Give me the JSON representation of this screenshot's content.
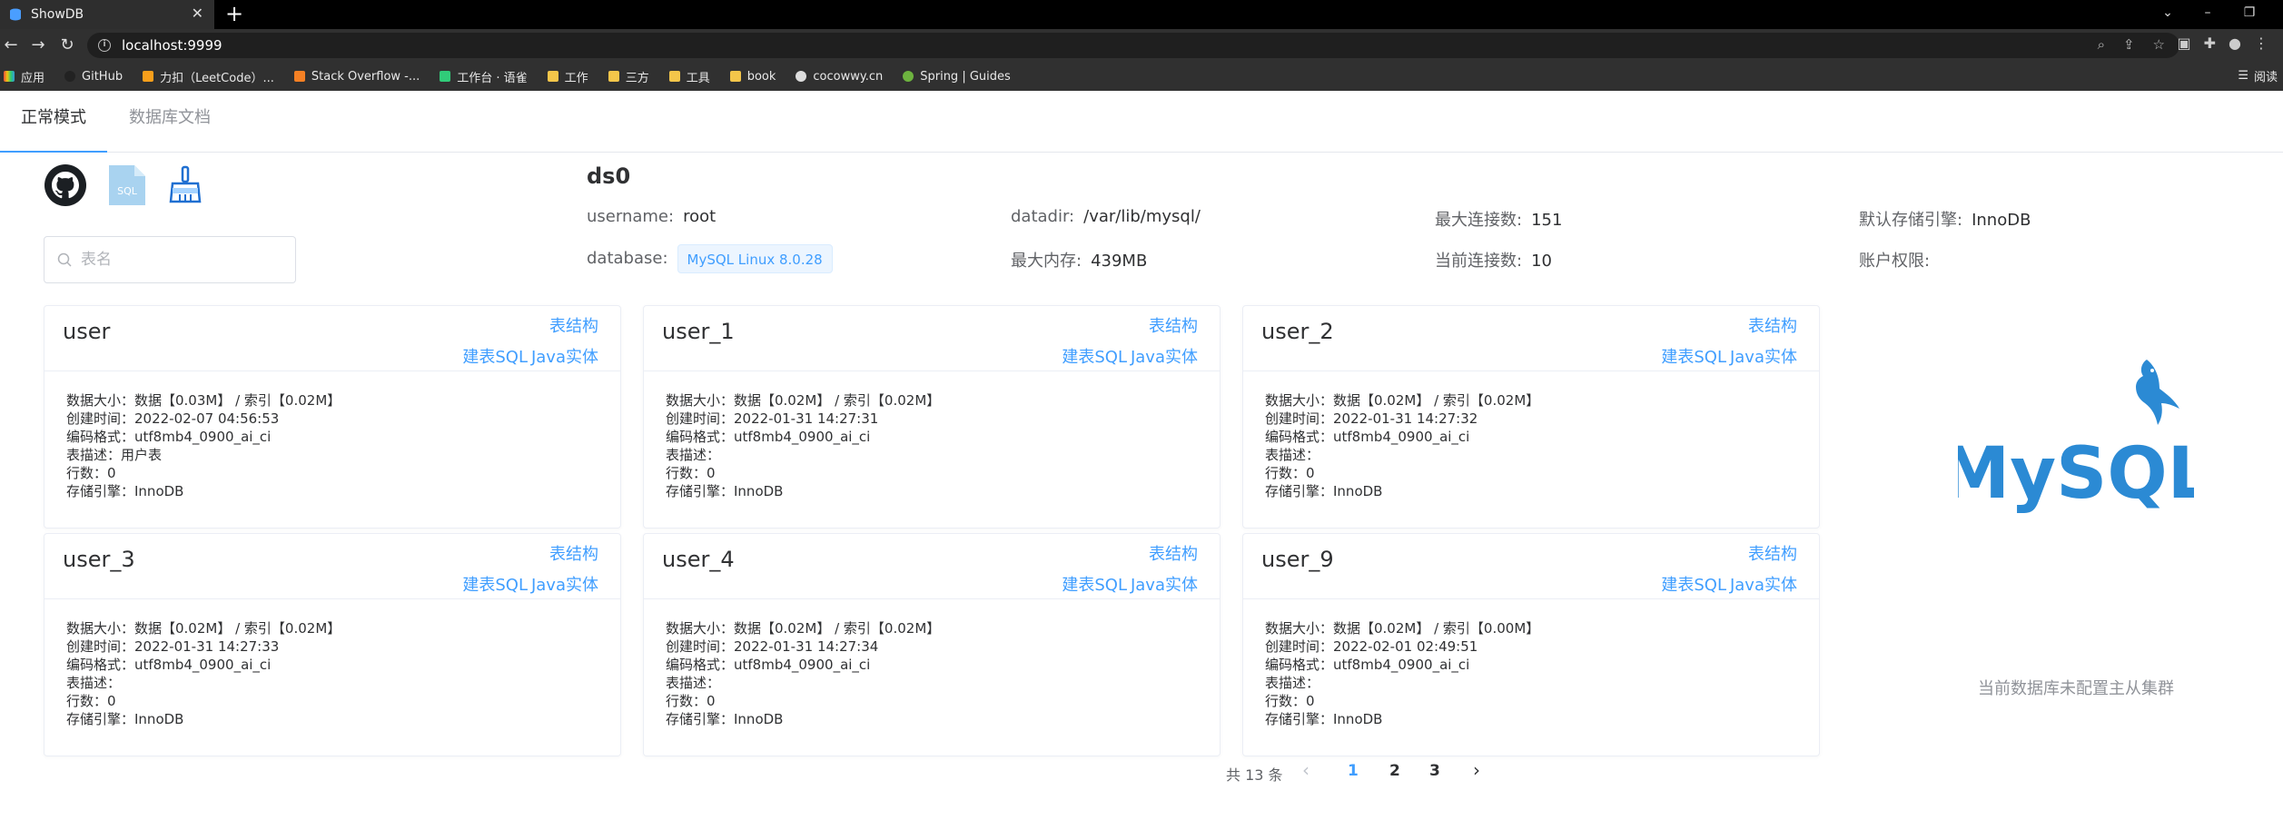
{
  "browser": {
    "tab_title": "ShowDB",
    "url": "localhost:9999",
    "bookmarks": [
      "应用",
      "GitHub",
      "力扣（LeetCode）...",
      "Stack Overflow -...",
      "工作台 · 语雀",
      "工作",
      "三方",
      "工具",
      "book",
      "cocowwy.cn",
      "Spring | Guides"
    ],
    "reading_list": "阅读"
  },
  "app_tabs": {
    "normal": "正常模式",
    "docs": "数据库文档"
  },
  "search": {
    "placeholder": "表名"
  },
  "db": {
    "name": "ds0",
    "username_label": "username:",
    "username": "root",
    "database_label": "database:",
    "database": "MySQL Linux 8.0.28",
    "datadir_label": "datadir:",
    "datadir": "/var/lib/mysql/",
    "max_mem_label": "最大内存:",
    "max_mem": "439MB",
    "max_conn_label": "最大连接数:",
    "max_conn": "151",
    "cur_conn_label": "当前连接数:",
    "cur_conn": "10",
    "engine_label": "默认存储引擎:",
    "engine": "InnoDB",
    "privilege_label": "账户权限:"
  },
  "card_links": {
    "structure": "表结构",
    "ddl": "建表SQL",
    "entity": "Java实体"
  },
  "tables": [
    {
      "name": "user",
      "size": "数据大小：数据【0.03M】 / 索引【0.02M】",
      "created": "创建时间：2022-02-07 04:56:53",
      "collation": "编码格式：utf8mb4_0900_ai_ci",
      "comment": "表描述：用户表",
      "rows": "行数：0",
      "engine": "存储引擎：InnoDB"
    },
    {
      "name": "user_1",
      "size": "数据大小：数据【0.02M】 / 索引【0.02M】",
      "created": "创建时间：2022-01-31 14:27:31",
      "collation": "编码格式：utf8mb4_0900_ai_ci",
      "comment": "表描述：",
      "rows": "行数：0",
      "engine": "存储引擎：InnoDB"
    },
    {
      "name": "user_2",
      "size": "数据大小：数据【0.02M】 / 索引【0.02M】",
      "created": "创建时间：2022-01-31 14:27:32",
      "collation": "编码格式：utf8mb4_0900_ai_ci",
      "comment": "表描述：",
      "rows": "行数：0",
      "engine": "存储引擎：InnoDB"
    },
    {
      "name": "user_3",
      "size": "数据大小：数据【0.02M】 / 索引【0.02M】",
      "created": "创建时间：2022-01-31 14:27:33",
      "collation": "编码格式：utf8mb4_0900_ai_ci",
      "comment": "表描述：",
      "rows": "行数：0",
      "engine": "存储引擎：InnoDB"
    },
    {
      "name": "user_4",
      "size": "数据大小：数据【0.02M】 / 索引【0.02M】",
      "created": "创建时间：2022-01-31 14:27:34",
      "collation": "编码格式：utf8mb4_0900_ai_ci",
      "comment": "表描述：",
      "rows": "行数：0",
      "engine": "存储引擎：InnoDB"
    },
    {
      "name": "user_9",
      "size": "数据大小：数据【0.02M】 / 索引【0.00M】",
      "created": "创建时间：2022-02-01 02:49:51",
      "collation": "编码格式：utf8mb4_0900_ai_ci",
      "comment": "表描述：",
      "rows": "行数：0",
      "engine": "存储引擎：InnoDB"
    }
  ],
  "side": {
    "logo_text": "MySQL",
    "cluster": "当前数据库未配置主从集群"
  },
  "pagination": {
    "total": "共 13 条",
    "pages": [
      "1",
      "2",
      "3"
    ],
    "current": "1"
  },
  "colors": {
    "primary": "#409eff",
    "mysql_blue": "#2b8ad4"
  }
}
